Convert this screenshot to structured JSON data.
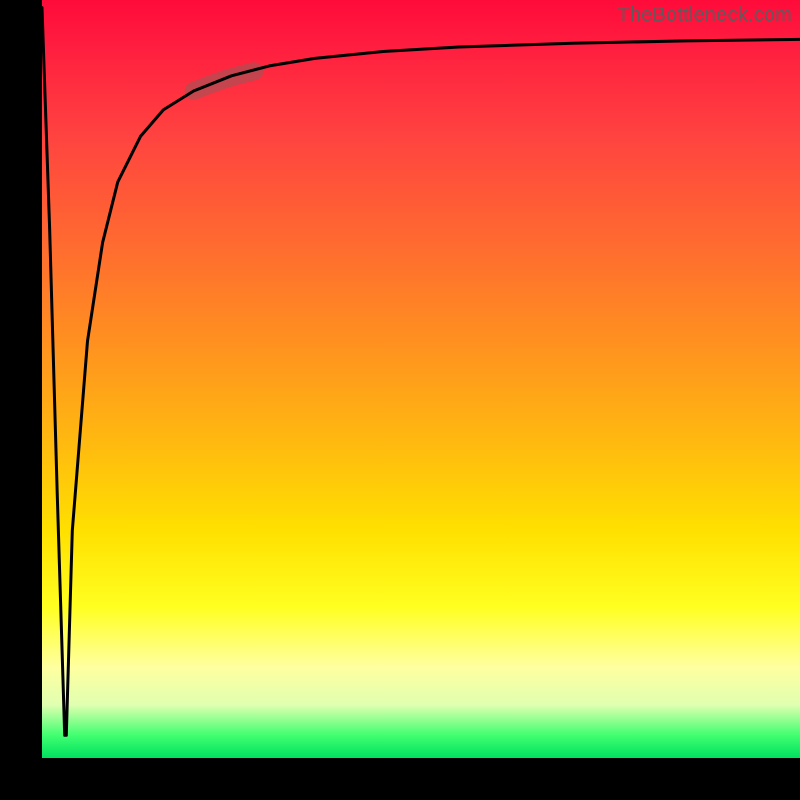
{
  "watermark": "TheBottleneck.com",
  "colors": {
    "gradient_top": "#ff0b3a",
    "gradient_mid_orange": "#ff9020",
    "gradient_mid_yellow": "#ffe000",
    "gradient_bottom": "#00e060",
    "curve": "#000000",
    "highlight": "rgba(150,90,90,0.55)",
    "frame": "#000000"
  },
  "chart_data": {
    "type": "line",
    "title": "",
    "xlabel": "",
    "ylabel": "",
    "xlim": [
      0,
      100
    ],
    "ylim": [
      0,
      100
    ],
    "series": [
      {
        "name": "bottleneck-curve",
        "comment": "Two-branch curve forming sharp dip near x≈3 then asymptote near y≈95. Values estimated from pixel positions; no axes/ticks are rendered so precision ±3.",
        "x": [
          0,
          1,
          2,
          3,
          3.2,
          4,
          6,
          8,
          10,
          13,
          16,
          20,
          25,
          30,
          36,
          45,
          55,
          70,
          85,
          100
        ],
        "y": [
          99,
          70,
          35,
          3,
          3,
          30,
          55,
          68,
          76,
          82,
          85.5,
          88,
          90,
          91.3,
          92.3,
          93.2,
          93.8,
          94.3,
          94.6,
          94.8
        ]
      },
      {
        "name": "highlight-segment",
        "comment": "Pale thick overlay marking a short region on the rising curve around x≈20–28.",
        "x": [
          20,
          22,
          24,
          26,
          28
        ],
        "y": [
          88,
          88.8,
          89.5,
          90.1,
          90.6
        ]
      }
    ],
    "background_gradient": {
      "direction": "vertical",
      "stops": [
        {
          "pos": 0.0,
          "hex": "#ff0b3a"
        },
        {
          "pos": 0.32,
          "hex": "#ff6a30"
        },
        {
          "pos": 0.58,
          "hex": "#ffb810"
        },
        {
          "pos": 0.8,
          "hex": "#ffff20"
        },
        {
          "pos": 0.93,
          "hex": "#e0ffb0"
        },
        {
          "pos": 1.0,
          "hex": "#00e060"
        }
      ]
    }
  }
}
